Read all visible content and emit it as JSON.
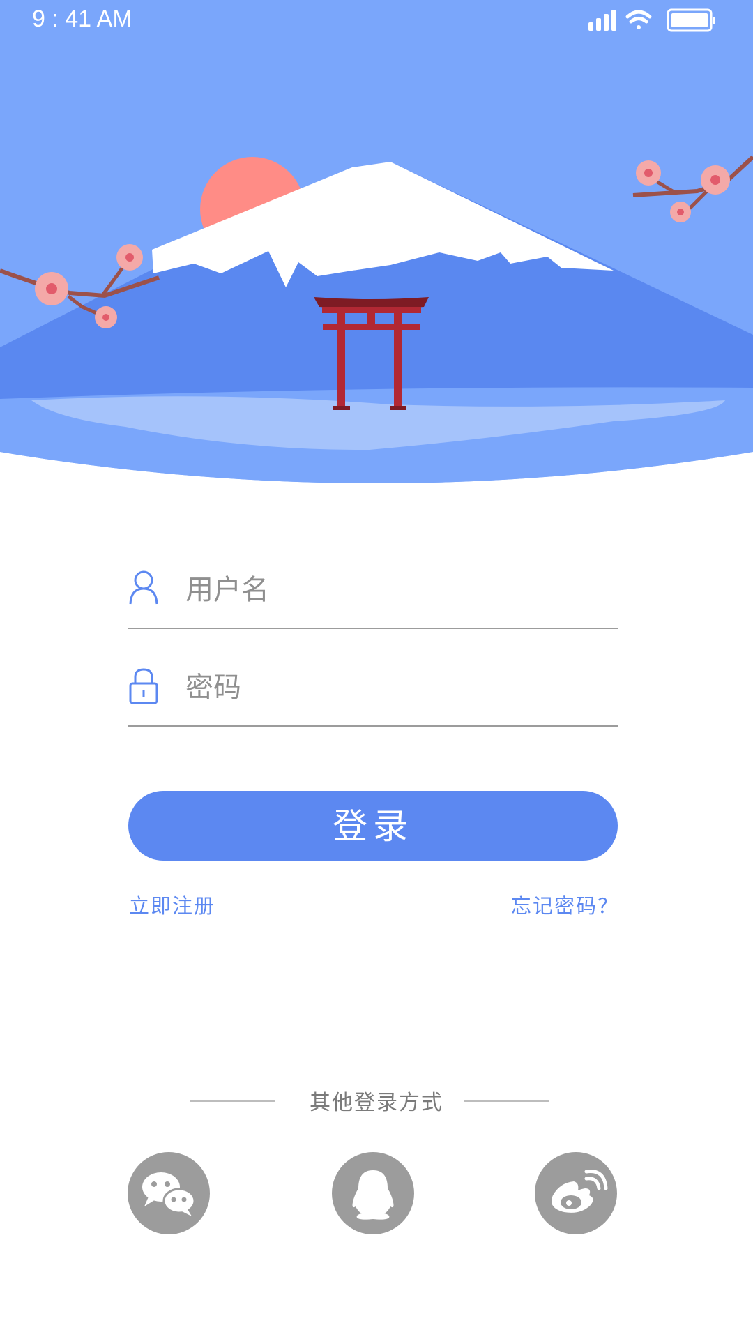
{
  "status_bar": {
    "time": "9 : 41 AM"
  },
  "form": {
    "username_placeholder": "用户名",
    "password_placeholder": "密码",
    "login_label": "登录",
    "register_label": "立即注册",
    "forgot_label": "忘记密码？"
  },
  "other_login": {
    "label": "其他登录方式",
    "providers": [
      "wechat-icon",
      "qq-icon",
      "weibo-icon"
    ]
  },
  "colors": {
    "sky": "#7aa6fb",
    "accent": "#5c88f1",
    "mountain": "#5b88f1",
    "sun": "#ff8c86",
    "torii": "#b22834",
    "social_gray": "#9c9c9c"
  }
}
